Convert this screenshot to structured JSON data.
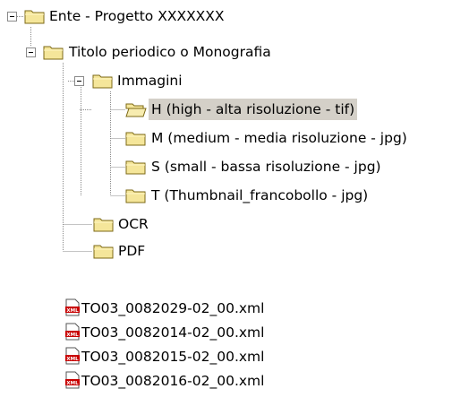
{
  "tree": [
    {
      "id": "ente",
      "label": "Ente - Progetto XXXXXXX",
      "icon": "folder-icon",
      "expanded": true
    },
    {
      "id": "titolo",
      "label": "Titolo periodico o Monografia",
      "icon": "folder-icon",
      "expanded": true
    },
    {
      "id": "immagini",
      "label": "Immagini",
      "icon": "folder-icon",
      "expanded": true
    },
    {
      "id": "h",
      "label": "H (high - alta risoluzione - tif)",
      "icon": "folder-open-icon",
      "selected": true
    },
    {
      "id": "m",
      "label": "M (medium - media risoluzione - jpg)",
      "icon": "folder-icon"
    },
    {
      "id": "s",
      "label": "S (small - bassa risoluzione - jpg)",
      "icon": "folder-icon"
    },
    {
      "id": "t",
      "label": "T (Thumbnail_francobollo - jpg)",
      "icon": "folder-icon"
    },
    {
      "id": "ocr",
      "label": "OCR",
      "icon": "folder-icon"
    },
    {
      "id": "pdf",
      "label": "PDF",
      "icon": "folder-icon"
    }
  ],
  "files": [
    {
      "label": "TO03_0082029-02_00.xml",
      "icon": "xml-file-icon",
      "badge": "XML"
    },
    {
      "label": "TO03_0082014-02_00.xml",
      "icon": "xml-file-icon",
      "badge": "XML"
    },
    {
      "label": "TO03_0082015-02_00.xml",
      "icon": "xml-file-icon",
      "badge": "XML"
    },
    {
      "label": "TO03_0082016-02_00.xml",
      "icon": "xml-file-icon",
      "badge": "XML"
    }
  ],
  "colors": {
    "folder_fill": "#f5e69a",
    "folder_stroke": "#7d6a17",
    "selection": "#d4d0c8",
    "tree_line": "#8a8a8a",
    "xml_badge": "#c80000"
  }
}
